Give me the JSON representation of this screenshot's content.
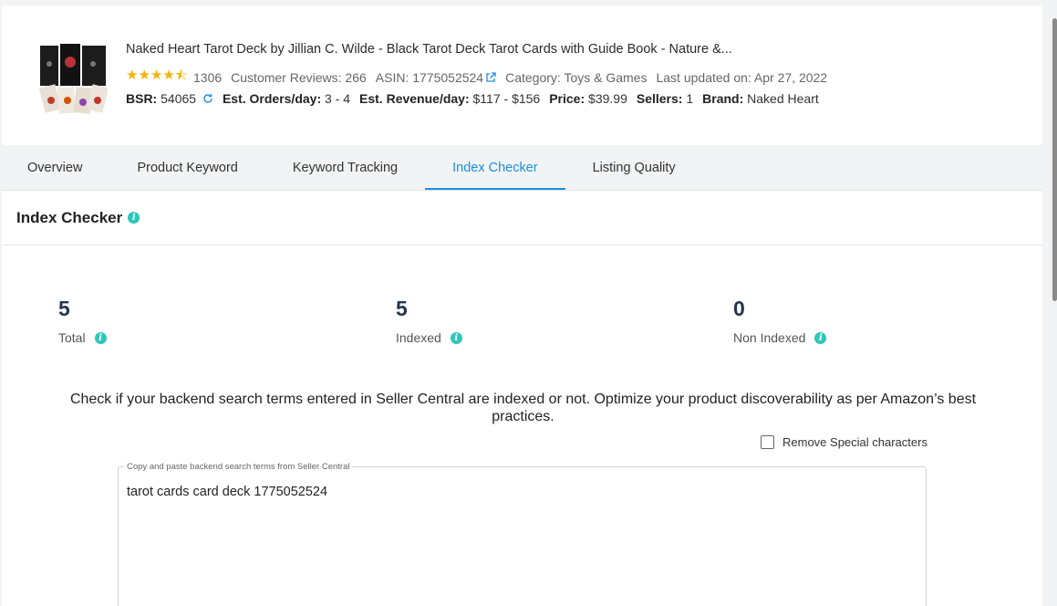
{
  "product": {
    "title": "Naked Heart Tarot Deck by Jillian C. Wilde - Black Tarot Deck Tarot Cards with Guide Book - Nature &...",
    "rating_stars": "★★★★⯪",
    "rating_count": "1306",
    "reviews": "Customer Reviews: 266",
    "asin": "ASIN: 1775052524",
    "category": "Category: Toys & Games",
    "last_updated": "Last updated on: Apr 27, 2022",
    "bsr_label": "BSR:",
    "bsr_value": "54065",
    "orders_label": "Est. Orders/day:",
    "orders_value": "3 - 4",
    "revenue_label": "Est. Revenue/day:",
    "revenue_value": "$117 - $156",
    "price_label": "Price:",
    "price_value": "$39.99",
    "sellers_label": "Sellers:",
    "sellers_value": "1",
    "brand_label": "Brand:",
    "brand_value": "Naked Heart"
  },
  "tabs": [
    {
      "label": "Overview"
    },
    {
      "label": "Product Keyword"
    },
    {
      "label": "Keyword Tracking"
    },
    {
      "label": "Index Checker"
    },
    {
      "label": "Listing Quality"
    }
  ],
  "panel": {
    "title": "Index Checker",
    "stats": [
      {
        "value": "5",
        "label": "Total"
      },
      {
        "value": "5",
        "label": "Indexed"
      },
      {
        "value": "0",
        "label": "Non Indexed"
      }
    ],
    "description": "Check if your backend search terms entered in Seller Central are indexed or not. Optimize your product discoverability as per Amazon’s best practices.",
    "checkbox_label": "Remove Special characters",
    "textarea_legend": "Copy and paste backend search terms from Seller Central",
    "textarea_value": "tarot cards card deck 1775052524"
  },
  "icons": {
    "info": "info-icon",
    "external_link": "external-link-icon",
    "refresh": "refresh-icon"
  },
  "colors": {
    "accent": "#1d8fe0",
    "info": "#2cc7b8",
    "star": "#f5b301"
  }
}
